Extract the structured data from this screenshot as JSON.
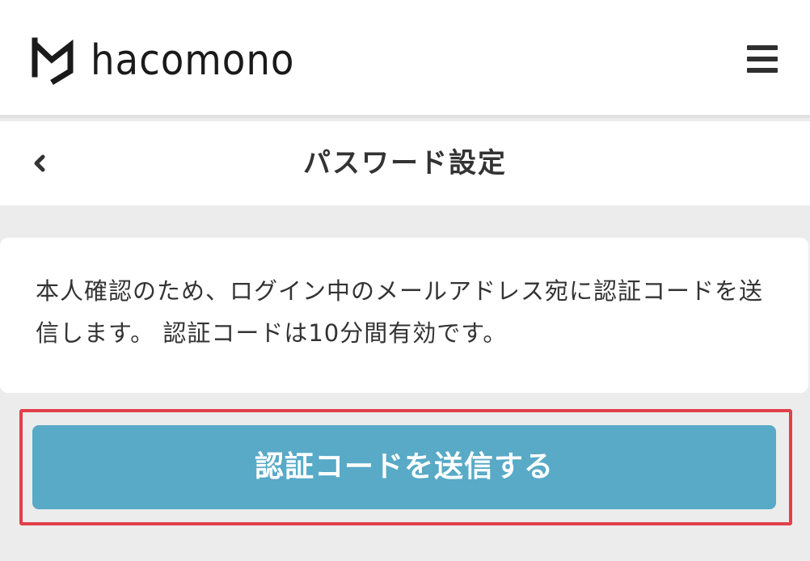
{
  "header": {
    "logo_text": "hacomono",
    "logo_icon": "hacomono-logo-icon",
    "menu_icon": "hamburger-menu-icon"
  },
  "titlebar": {
    "back_icon": "chevron-left-icon",
    "title": "パスワード設定"
  },
  "card": {
    "text": "本人確認のため、ログイン中のメールアドレス宛に認証コードを送信します。 認証コードは10分間有効です。"
  },
  "actions": {
    "send_code_label": "認証コードを送信する"
  },
  "colors": {
    "primary": "#58aac7",
    "highlight": "#e0404a",
    "background": "#ececec",
    "text": "#333333"
  }
}
